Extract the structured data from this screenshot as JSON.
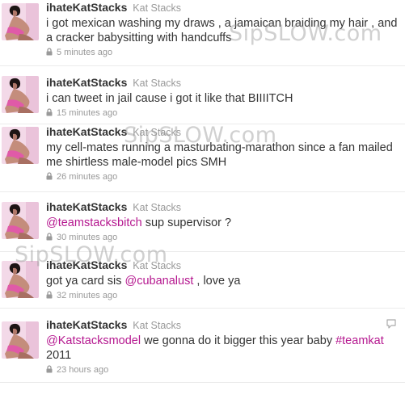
{
  "tweets": [
    {
      "screen_name": "ihateKatStacks",
      "full_name": "Kat Stacks",
      "text_parts": [
        {
          "type": "text",
          "value": "i got mexican washing my draws , a jamaican braiding my hair , and a cracker babysitting with handcuffs"
        }
      ],
      "timestamp": "5 minutes ago"
    },
    {
      "screen_name": "ihateKatStacks",
      "full_name": "Kat Stacks",
      "text_parts": [
        {
          "type": "text",
          "value": "i can tweet in jail cause i got it like that BIIIITCH"
        }
      ],
      "timestamp": "15 minutes ago"
    },
    {
      "screen_name": "ihateKatStacks",
      "full_name": "Kat Stacks",
      "text_parts": [
        {
          "type": "text",
          "value": "my cell-mates running a masturbating-marathon since a fan mailed me shirtless male-model pics SMH"
        }
      ],
      "timestamp": "26 minutes ago"
    },
    {
      "screen_name": "ihateKatStacks",
      "full_name": "Kat Stacks",
      "text_parts": [
        {
          "type": "mention",
          "value": "@teamstacksbitch"
        },
        {
          "type": "text",
          "value": " sup supervisor ?"
        }
      ],
      "timestamp": "30 minutes ago"
    },
    {
      "screen_name": "ihateKatStacks",
      "full_name": "Kat Stacks",
      "text_parts": [
        {
          "type": "text",
          "value": "got ya card sis "
        },
        {
          "type": "mention",
          "value": "@cubanalust"
        },
        {
          "type": "text",
          "value": " , love ya"
        }
      ],
      "timestamp": "32 minutes ago"
    },
    {
      "screen_name": "ihateKatStacks",
      "full_name": "Kat Stacks",
      "text_parts": [
        {
          "type": "mention",
          "value": "@Katstacksmodel"
        },
        {
          "type": "text",
          "value": " we gonna do it bigger this year baby "
        },
        {
          "type": "hashtag",
          "value": "#teamkat"
        },
        {
          "type": "text",
          "value": " 2011"
        }
      ],
      "timestamp": "23 hours ago"
    }
  ],
  "watermarks": [
    "SipSLOW.com",
    "SipSLOW.com",
    "SipSLOW.com"
  ],
  "colors": {
    "link": "#b5178f",
    "name": "#333333",
    "muted": "#999999",
    "divider": "#ebebeb"
  },
  "icons": {
    "lock": "lock-icon",
    "reply": "reply-icon",
    "avatar": "avatar"
  }
}
